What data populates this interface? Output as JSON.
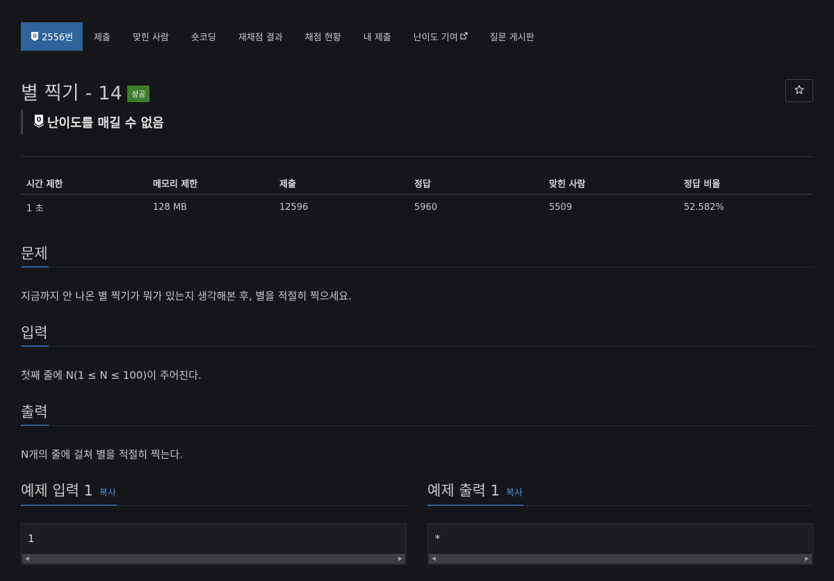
{
  "tabs": {
    "problem_number": "2556번",
    "items": [
      "제출",
      "맞힌 사람",
      "숏코딩",
      "재채점 결과",
      "채점 현황",
      "내 제출",
      "난이도 기여",
      "질문 게시판"
    ]
  },
  "title": "별 찍기 - 14",
  "badge": "성공",
  "difficulty_text": "난이도를 매길 수 없음",
  "stats": {
    "headers": [
      "시간 제한",
      "메모리 제한",
      "제출",
      "정답",
      "맞힌 사람",
      "정답 비율"
    ],
    "values": [
      "1 초",
      "128 MB",
      "12596",
      "5960",
      "5509",
      "52.582%"
    ]
  },
  "sections": {
    "problem": {
      "heading": "문제",
      "text": "지금까지 안 나온 별 찍기가 뭐가 있는지 생각해본 후, 별을 적절히 찍으세요."
    },
    "input": {
      "heading": "입력",
      "text": "첫째 줄에 N(1 ≤ N ≤ 100)이 주어진다."
    },
    "output": {
      "heading": "출력",
      "text": "N개의 줄에 걸쳐 별을 적절히 찍는다."
    }
  },
  "examples": {
    "input_heading": "예제 입력 1",
    "output_heading": "예제 출력 1",
    "copy_label": "복사",
    "input_value": "1",
    "output_value": "*"
  },
  "colors": {
    "background": "#151619",
    "active_tab": "#2f6399",
    "success_badge": "#3f7d2e",
    "link": "#4d8fd1"
  },
  "icons": {
    "tier": "unrated-tier-icon",
    "external": "external-link-icon",
    "star": "star-icon"
  }
}
